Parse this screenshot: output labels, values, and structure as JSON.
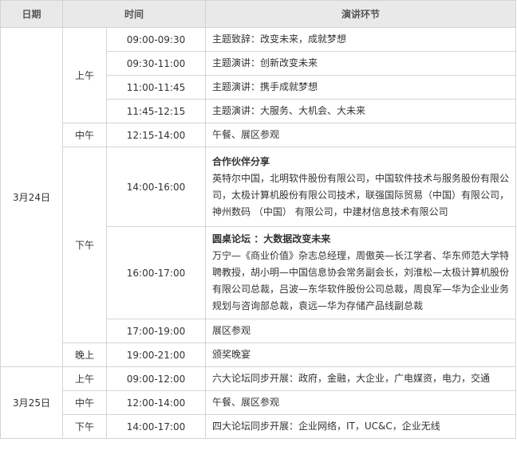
{
  "header": {
    "date": "日期",
    "time": "时间",
    "session": "演讲环节"
  },
  "day1": {
    "date": "3月24日",
    "morning": "上午",
    "noon": "中午",
    "afternoon": "下午",
    "evening": "晚上",
    "rows": [
      {
        "time": "09:00-09:30",
        "detail": "主题致辞：改变未来，成就梦想"
      },
      {
        "time": "09:30-11:00",
        "detail": "主题演讲：创新改变未来"
      },
      {
        "time": "11:00-11:45",
        "detail": "主题演讲：携手成就梦想"
      },
      {
        "time": "11:45-12:15",
        "detail": "主题演讲：大服务、大机会、大未来"
      },
      {
        "time": "12:15-14:00",
        "detail": "午餐、展区参观"
      },
      {
        "time": "14:00-16:00",
        "title": "合作伙伴分享",
        "detail": "英特尔中国，北明软件股份有限公司，中国软件技术与服务股份有限公司，太极计算机股份有限公司技术，联强国际贸易（中国）有限公司，神州数码 （中国） 有限公司，中建材信息技术有限公司"
      },
      {
        "time": "16:00-17:00",
        "title": "圆桌论坛 ：大数据改变未来",
        "detail": "万宁—《商业价值》杂志总经理，周傲英—长江学者、华东师范大学特聘教授，胡小明—中国信息协会常务副会长，刘淮松—太极计算机股份有限公司总裁，吕波—东华软件股份公司总裁，周良军—华为企业业务规划与咨询部总裁，袁远—华为存储产品线副总裁"
      },
      {
        "time": "17:00-19:00",
        "detail": "展区参观"
      },
      {
        "time": "19:00-21:00",
        "detail": "颁奖晚宴"
      }
    ]
  },
  "day2": {
    "date": "3月25日",
    "morning": "上午",
    "noon": "中午",
    "afternoon": "下午",
    "rows": [
      {
        "time": "09:00-12:00",
        "detail": "六大论坛同步开展：政府，金融，大企业，广电媒资，电力，交通"
      },
      {
        "time": "12:00-14:00",
        "detail": "午餐、展区参观"
      },
      {
        "time": "14:00-17:00",
        "detail": "四大论坛同步开展：企业网络，IT，UC&C，企业无线"
      }
    ]
  }
}
